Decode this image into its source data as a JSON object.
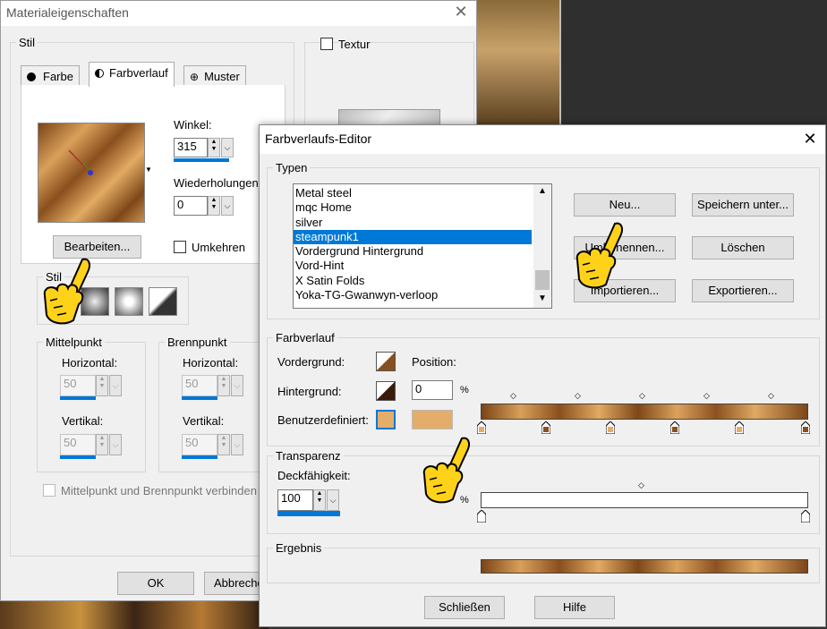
{
  "mat": {
    "title": "Materialeigenschaften",
    "stil_label": "Stil",
    "textur_label": "Textur",
    "tabs": [
      {
        "label": "Farbe",
        "icon": "circle-icon"
      },
      {
        "label": "Farbverlauf",
        "icon": "half-circle-icon"
      },
      {
        "label": "Muster",
        "icon": "pattern-icon"
      }
    ],
    "winkel_label": "Winkel:",
    "winkel_value": "315",
    "wiederholungen_label": "Wiederholungen:",
    "wiederholungen_value": "0",
    "bearbeiten": "Bearbeiten...",
    "umkehren": "Umkehren",
    "stil2_label": "Stil",
    "mittelpunkt_label": "Mittelpunkt",
    "brennpunkt_label": "Brennpunkt",
    "horizontal_label": "Horizontal:",
    "vertikal_label": "Vertikal:",
    "mp_h": "50",
    "mp_v": "50",
    "bp_h": "50",
    "bp_v": "50",
    "verbinden": "Mittelpunkt und Brennpunkt verbinden",
    "ok": "OK",
    "abbrechen": "Abbrechen"
  },
  "editor": {
    "title": "Farbverlaufs-Editor",
    "typen_label": "Typen",
    "list": [
      "Metal steel",
      "mqc Home",
      "silver",
      "steampunk1",
      "Vordergrund Hintergrund",
      "Vord-Hint",
      "X Satin Folds",
      "Yoka-TG-Gwanwyn-verloop"
    ],
    "selected_index": 3,
    "btn_neu": "Neu...",
    "btn_speichern": "Speichern unter...",
    "btn_umbenennen": "Umbenennen...",
    "btn_loeschen": "Löschen",
    "btn_importieren": "Importieren...",
    "btn_exportieren": "Exportieren...",
    "farbverlauf_label": "Farbverlauf",
    "vordergrund": "Vordergrund:",
    "hintergrund": "Hintergrund:",
    "benutzerdefiniert": "Benutzerdefiniert:",
    "position": "Position:",
    "position_value": "0",
    "percent": "%",
    "transparenz_label": "Transparenz",
    "deckfaehigkeit": "Deckfähigkeit:",
    "deck_value": "100",
    "ergebnis_label": "Ergebnis",
    "schliessen": "Schließen",
    "hilfe": "Hilfe",
    "custom_color": "#e5ad6a"
  }
}
